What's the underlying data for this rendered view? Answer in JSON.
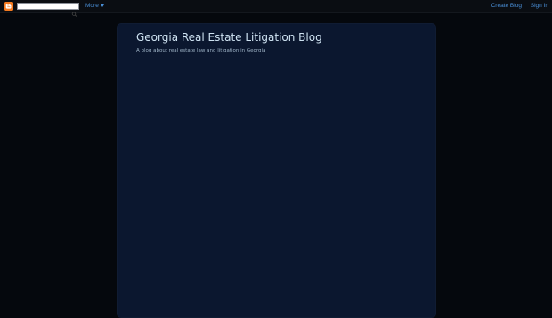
{
  "navbar": {
    "logo_icon": "blogger-icon",
    "search_value": "",
    "search_icon": "search-icon",
    "more_label": "More",
    "create_blog_label": "Create Blog",
    "sign_in_label": "Sign In"
  },
  "blog": {
    "title": "Georgia Real Estate Litigation Blog",
    "description": "A blog about real estate law and litigation in Georgia"
  },
  "colors": {
    "page_background": "#05080d",
    "content_background": "#0b172f",
    "link": "#4a90d9",
    "title": "#cfe3f2",
    "logo": "#f47a20"
  }
}
